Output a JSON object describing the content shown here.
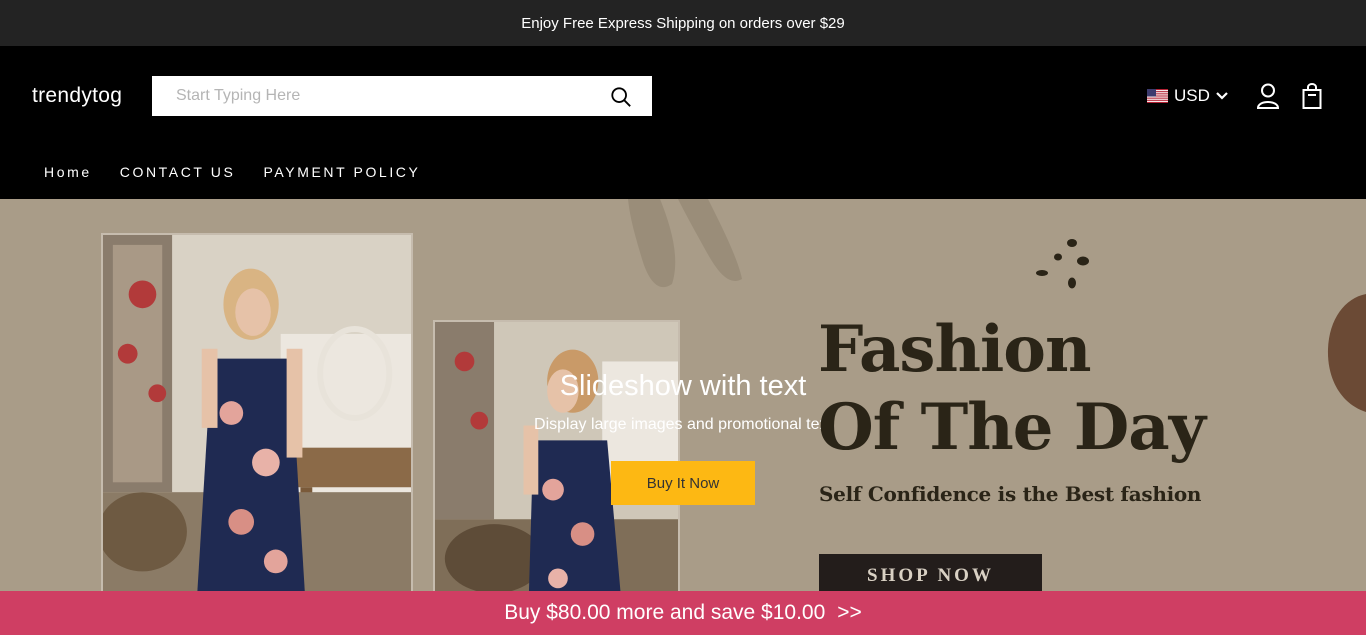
{
  "announcement": {
    "text": "Enjoy Free Express Shipping on orders over $29"
  },
  "header": {
    "logo": "trendytog",
    "search": {
      "placeholder": "Start Typing Here",
      "value": "",
      "icon": "search-icon"
    },
    "currency": {
      "code": "USD",
      "flag": "us-flag-icon",
      "icon": "chevron-down-icon"
    },
    "account_icon": "user-icon",
    "cart_icon": "shopping-bag-icon"
  },
  "nav": {
    "items": [
      {
        "label": "Home"
      },
      {
        "label": "CONTACT US"
      },
      {
        "label": "PAYMENT POLICY"
      }
    ]
  },
  "hero": {
    "slide_title": "Slideshow with text",
    "slide_subtitle": "Display large images and promotional text",
    "cta_label": "Buy It Now",
    "banner_line1": "Fashion",
    "banner_line2": "Of The Day",
    "banner_tagline": "Self Confidence is the Best fashion",
    "banner_button": "SHOP NOW"
  },
  "promo_bar": {
    "text": "Buy $80.00 more and save $10.00",
    "arrow": ">>"
  },
  "colors": {
    "announce_bg": "#232323",
    "header_bg": "#000000",
    "hero_bg": "#a99c88",
    "cta_bg": "#fdb813",
    "promo_bg": "#cf3e63",
    "banner_text": "#2a2417"
  }
}
